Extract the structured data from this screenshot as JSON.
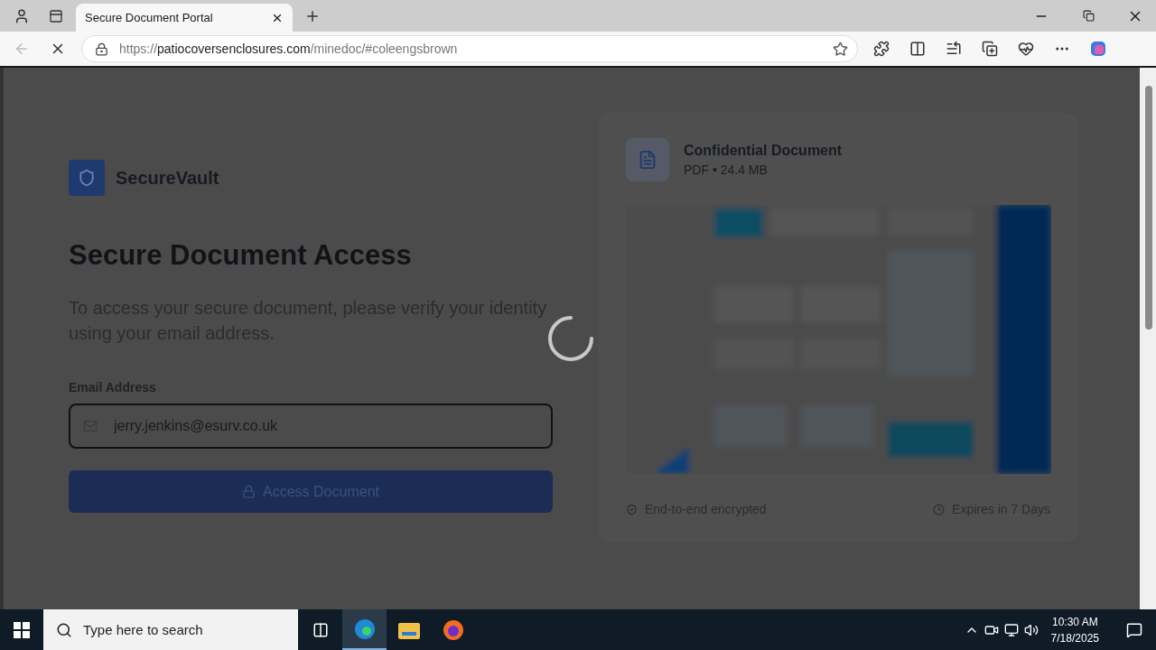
{
  "browser": {
    "tab_title": "Secure Document Portal",
    "url": {
      "scheme": "https://",
      "host": "patiocoversenclosures.com",
      "path": "/minedoc/#coleengsbrown"
    }
  },
  "page": {
    "loading": true,
    "brand": "SecureVault",
    "heading": "Secure Document Access",
    "description": "To access your secure document, please verify your identity using your email address.",
    "email_label": "Email Address",
    "email_value": "jerry.jenkins@esurv.co.uk",
    "button": {
      "label": "Access Document",
      "disabled": true
    },
    "document": {
      "title": "Confidential Document",
      "meta": "PDF • 24.4 MB"
    },
    "footer": [
      {
        "kind": "encrypted",
        "text": "End-to-end encrypted"
      },
      {
        "kind": "expires",
        "text": "Expires in 7 Days"
      }
    ]
  },
  "taskbar": {
    "search_placeholder": "Type here to search",
    "time": "10:30 AM",
    "date": "7/18/2025"
  }
}
